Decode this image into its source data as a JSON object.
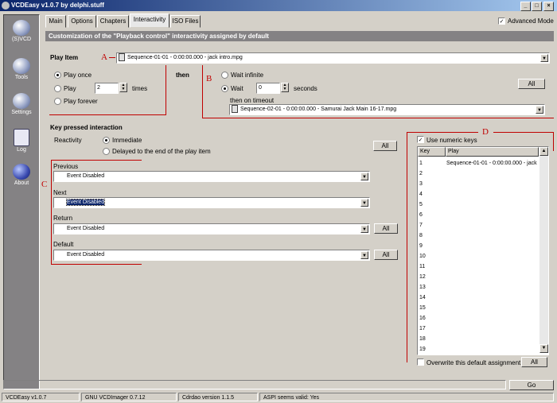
{
  "window": {
    "title": "VCDEasy v1.0.7 by delphi.stuff"
  },
  "sidebar": {
    "items": [
      {
        "label": "(S)VCD",
        "icon": "disc-icon"
      },
      {
        "label": "Tools",
        "icon": "tools-icon"
      },
      {
        "label": "Settings",
        "icon": "settings-icon"
      },
      {
        "label": "Log",
        "icon": "log-icon"
      },
      {
        "label": "About",
        "icon": "info-icon"
      }
    ]
  },
  "tabs": [
    "Main",
    "Options",
    "Chapters",
    "Interactivity",
    "ISO Files"
  ],
  "active_tab": "Interactivity",
  "advanced_mode": {
    "label": "Advanced Mode",
    "checked": true,
    "mark": "✓"
  },
  "header": "Customization of the \"Playback control\" interactivity assigned by default",
  "play_item": {
    "label": "Play Item",
    "value": "Sequence-01-01 - 0:00:00.000 - jack intro.mpg",
    "play_once": "Play once",
    "play": "Play",
    "play_times_value": "2",
    "times": "times",
    "play_forever": "Play forever",
    "then": "then",
    "wait_infinite": "Wait infinite",
    "wait": "Wait",
    "wait_value": "0",
    "seconds": "seconds",
    "all_label": "All",
    "then_on_timeout": "then on timeout",
    "timeout_value": "Sequence-02-01 - 0:00:00.000 - Samurai Jack Main 16-17.mpg"
  },
  "key_pressed": {
    "title": "Key pressed interaction",
    "reactivity": "Reactivity",
    "immediate": "Immediate",
    "delayed": "Delayed to the end of the play item",
    "all_label": "All",
    "previous": {
      "label": "Previous",
      "value": "Event Disabled"
    },
    "next": {
      "label": "Next",
      "value": "Event Disabled"
    },
    "return": {
      "label": "Return",
      "value": "Event Disabled",
      "all": "All"
    },
    "default": {
      "label": "Default",
      "value": "Event Disabled",
      "all": "All"
    }
  },
  "annotations": {
    "A": "A",
    "B": "B",
    "C": "C",
    "D": "D"
  },
  "numeric_keys": {
    "label": "Use numeric keys",
    "checked": true,
    "mark": "✓",
    "columns": [
      "Key",
      "Play"
    ],
    "rows": [
      {
        "key": "1",
        "play": "Sequence-01-01 - 0:00:00.000 - jack"
      },
      {
        "key": "2",
        "play": ""
      },
      {
        "key": "3",
        "play": ""
      },
      {
        "key": "4",
        "play": ""
      },
      {
        "key": "5",
        "play": ""
      },
      {
        "key": "6",
        "play": ""
      },
      {
        "key": "7",
        "play": ""
      },
      {
        "key": "8",
        "play": ""
      },
      {
        "key": "9",
        "play": ""
      },
      {
        "key": "10",
        "play": ""
      },
      {
        "key": "11",
        "play": ""
      },
      {
        "key": "12",
        "play": ""
      },
      {
        "key": "13",
        "play": ""
      },
      {
        "key": "14",
        "play": ""
      },
      {
        "key": "15",
        "play": ""
      },
      {
        "key": "16",
        "play": ""
      },
      {
        "key": "17",
        "play": ""
      },
      {
        "key": "18",
        "play": ""
      },
      {
        "key": "19",
        "play": ""
      }
    ],
    "overwrite_label": "Overwrite this default assignment",
    "all_label": "All"
  },
  "go_label": "Go",
  "status": [
    "VCDEasy v1.0.7",
    "GNU VCDImager 0.7.12",
    "Cdrdao version 1.1.5",
    "ASPI seems valid: Yes"
  ]
}
